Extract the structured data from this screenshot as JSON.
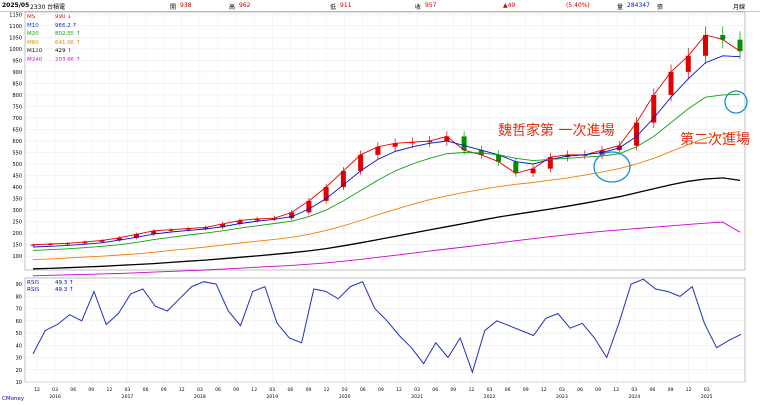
{
  "topbar": {
    "date": "2025/05",
    "stock": "2330 台積電",
    "open_label": "開",
    "open_val": "938",
    "high_label": "高",
    "high_val": "962",
    "low_label": "低",
    "low_val": "911",
    "close_label": "收",
    "close_val": "957",
    "change": "▲49",
    "pct": "(5.40%)",
    "vol_label": "量",
    "vol_val": "284347",
    "unit": "張",
    "period": "月線"
  },
  "legend": [
    {
      "name": "MS",
      "value": "990 ↓",
      "color": "#e00000"
    },
    {
      "name": "M10",
      "value": "966.2 ↑",
      "color": "#0010d0"
    },
    {
      "name": "M20",
      "value": "802.55 ↑",
      "color": "#10a010"
    },
    {
      "name": "M60",
      "value": "641.08 ↑",
      "color": "#f08000"
    },
    {
      "name": "M120",
      "value": "429 ↑",
      "color": "#000000"
    },
    {
      "name": "M240",
      "value": "203.66 ↑",
      "color": "#d000d0"
    }
  ],
  "rsi_legend": [
    {
      "name": "RSI5",
      "value": "49.3 ↑"
    },
    {
      "name": "RSI5",
      "value": "49.3 ↑"
    }
  ],
  "annotations": {
    "first_entry": "魏哲家第 一次進場",
    "second_entry": "第二次進場"
  },
  "footer": "CMoney",
  "colors": {
    "up": "#e00000",
    "down": "#009000",
    "ma5": "#e00000",
    "ma10": "#0010d0",
    "ma20": "#10a010",
    "ma60": "#f08000",
    "ma120": "#000000",
    "ma240": "#d000d0",
    "rsi": "#2030c0",
    "circle": "#1090d0",
    "annot": "#e03010"
  },
  "chart_data": [
    {
      "type": "line",
      "title": "",
      "xlabel": "",
      "ylabel": "",
      "ylim": [
        40,
        1160
      ],
      "yticks": [
        100,
        150,
        200,
        250,
        300,
        350,
        400,
        450,
        500,
        550,
        600,
        650,
        700,
        750,
        800,
        850,
        900,
        950,
        1000,
        1050,
        1100,
        1150
      ],
      "x_month_labels": [
        "12",
        "03",
        "06",
        "09",
        "12",
        "03",
        "06",
        "09",
        "12",
        "03",
        "06",
        "09",
        "12",
        "03",
        "06",
        "09",
        "12",
        "03",
        "06",
        "09",
        "12",
        "03",
        "06",
        "09",
        "12",
        "03",
        "06",
        "09",
        "12",
        "03",
        "06",
        "09",
        "12",
        "03",
        "06",
        "09",
        "12",
        "03"
      ],
      "x_year_labels": [
        "2016",
        "2017",
        "2018",
        "2019",
        "2020",
        "2021",
        "2022",
        "2023",
        "2024",
        "2025"
      ],
      "series": [
        {
          "name": "MS",
          "values": [
            150,
            153,
            156,
            162,
            168,
            180,
            195,
            210,
            215,
            220,
            225,
            240,
            255,
            262,
            265,
            290,
            340,
            400,
            470,
            540,
            575,
            590,
            595,
            600,
            620,
            560,
            540,
            510,
            460,
            480,
            530,
            540,
            540,
            560,
            580,
            680,
            800,
            900,
            970,
            1060,
            1040,
            990
          ]
        },
        {
          "name": "M10",
          "values": [
            140,
            143,
            147,
            152,
            158,
            170,
            182,
            196,
            205,
            212,
            218,
            228,
            242,
            252,
            260,
            272,
            305,
            350,
            410,
            470,
            520,
            555,
            575,
            590,
            600,
            580,
            560,
            540,
            510,
            500,
            520,
            535,
            540,
            550,
            570,
            620,
            700,
            790,
            870,
            940,
            970,
            966
          ]
        },
        {
          "name": "M20",
          "values": [
            125,
            128,
            132,
            137,
            143,
            150,
            160,
            172,
            182,
            192,
            200,
            210,
            222,
            232,
            242,
            252,
            272,
            300,
            340,
            385,
            430,
            470,
            500,
            525,
            545,
            550,
            548,
            540,
            525,
            515,
            520,
            525,
            530,
            535,
            545,
            575,
            620,
            680,
            740,
            790,
            800,
            803
          ]
        },
        {
          "name": "M60",
          "values": [
            85,
            88,
            92,
            96,
            100,
            105,
            110,
            117,
            125,
            132,
            140,
            148,
            157,
            165,
            173,
            182,
            195,
            212,
            232,
            255,
            280,
            303,
            325,
            345,
            362,
            377,
            390,
            402,
            412,
            420,
            430,
            440,
            452,
            465,
            480,
            500,
            525,
            555,
            585,
            612,
            630,
            641
          ]
        },
        {
          "name": "M120",
          "values": [
            45,
            47,
            50,
            53,
            56,
            60,
            64,
            68,
            73,
            78,
            83,
            89,
            95,
            101,
            108,
            115,
            123,
            133,
            145,
            158,
            172,
            186,
            200,
            214,
            228,
            242,
            256,
            270,
            282,
            293,
            305,
            317,
            330,
            344,
            358,
            375,
            393,
            410,
            425,
            435,
            440,
            429
          ]
        },
        {
          "name": "M240",
          "values": [
            15,
            17,
            19,
            21,
            23,
            25,
            28,
            31,
            34,
            37,
            40,
            44,
            48,
            52,
            56,
            60,
            65,
            71,
            78,
            86,
            95,
            104,
            113,
            122,
            131,
            140,
            149,
            158,
            167,
            176,
            185,
            193,
            201,
            208,
            214,
            220,
            226,
            232,
            238,
            243,
            248,
            204
          ]
        }
      ]
    },
    {
      "type": "line",
      "title": "",
      "ylim": [
        10,
        95
      ],
      "yticks": [
        10,
        20,
        30,
        40,
        50,
        60,
        70,
        80,
        90
      ],
      "series": [
        {
          "name": "RSI5",
          "values": [
            33,
            52,
            57,
            65,
            60,
            84,
            57,
            66,
            82,
            86,
            72,
            68,
            78,
            88,
            92,
            90,
            68,
            56,
            84,
            88,
            58,
            46,
            42,
            86,
            84,
            78,
            88,
            92,
            70,
            60,
            48,
            38,
            25,
            42,
            30,
            46,
            18,
            52,
            60,
            56,
            52,
            48,
            62,
            66,
            54,
            58,
            46,
            30,
            58,
            90,
            94,
            86,
            84,
            80,
            88,
            58,
            38,
            44,
            49
          ]
        }
      ]
    }
  ]
}
